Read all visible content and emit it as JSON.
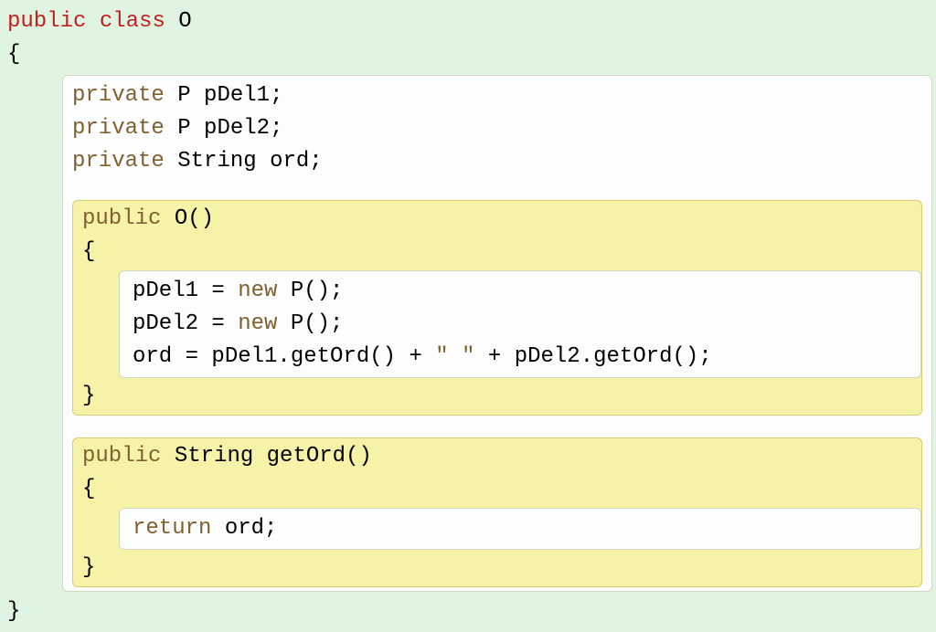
{
  "class_decl": {
    "kw_public": "public",
    "kw_class": "class",
    "name": "O"
  },
  "brace_open": "{",
  "brace_close": "}",
  "semicolon": ";",
  "fields": {
    "f1": {
      "kw": "private",
      "type": "P",
      "name": "pDel1"
    },
    "f2": {
      "kw": "private",
      "type": "P",
      "name": "pDel2"
    },
    "f3": {
      "kw": "private",
      "type": "String",
      "name": "ord"
    }
  },
  "ctor": {
    "kw_public": "public",
    "name": "O",
    "parens": "()",
    "body": {
      "l1_lhs": "pDel1 = ",
      "l1_new": "new",
      "l1_rhs": " P();",
      "l2_lhs": "pDel2 = ",
      "l2_new": "new",
      "l2_rhs": " P();",
      "l3_a": "ord = pDel1.getOrd() + ",
      "l3_s": "\" \"",
      "l3_b": " + pDel2.getOrd();"
    }
  },
  "method": {
    "kw_public": "public",
    "ret": "String",
    "name": "getOrd",
    "parens": "()",
    "body": {
      "kw_return": "return",
      "expr": " ord;"
    }
  }
}
